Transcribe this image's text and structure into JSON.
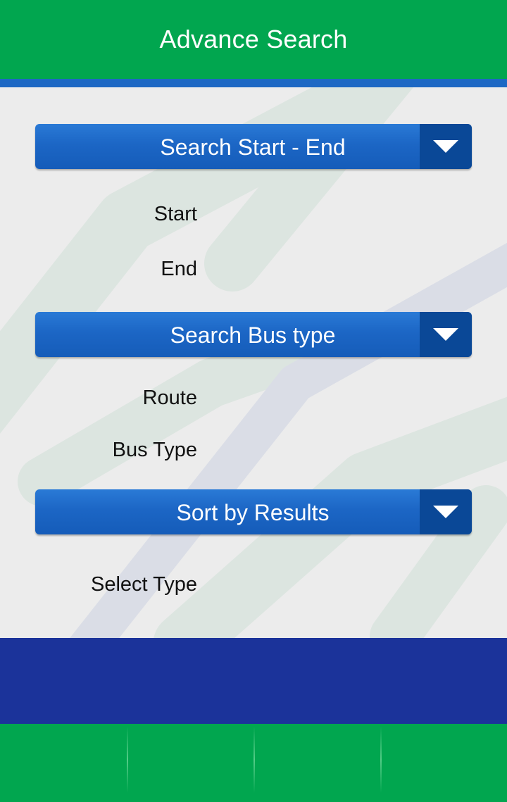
{
  "header": {
    "title": "Advance Search"
  },
  "sections": {
    "start_end": {
      "label": "Search Start - End",
      "fields": {
        "start": "Start",
        "end": "End"
      }
    },
    "bus_type": {
      "label": "Search Bus type",
      "fields": {
        "route": "Route",
        "bus_type": "Bus Type"
      }
    },
    "sort": {
      "label": "Sort by Results",
      "fields": {
        "select_type": "Select Type"
      }
    }
  },
  "icons": {
    "dropdown_arrow": "chevron-down-icon"
  },
  "colors": {
    "header_green": "#01a64f",
    "accent_blue": "#1d68c4",
    "banner_navy": "#1b339a",
    "background": "#ececec"
  },
  "tabbar": {
    "tab_count": 4
  }
}
